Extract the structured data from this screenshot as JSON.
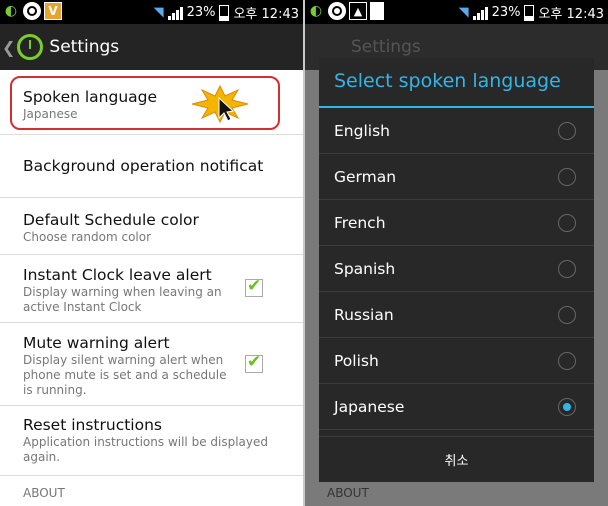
{
  "status": {
    "battery_percent": "23%",
    "time": "오후 12:43",
    "vicon": "V"
  },
  "left": {
    "title": "Settings",
    "items": [
      {
        "title": "Spoken language",
        "subtitle": "Japanese"
      },
      {
        "title": "Background operation notificat",
        "subtitle": ""
      },
      {
        "title": "Default Schedule color",
        "subtitle": "Choose random color"
      },
      {
        "title": "Instant Clock leave alert",
        "subtitle": "Display warning when leaving an active Instant Clock",
        "checked": true
      },
      {
        "title": "Mute warning alert",
        "subtitle": "Display silent warning alert when phone mute is set and a schedule is running.",
        "checked": true
      },
      {
        "title": "Reset instructions",
        "subtitle": "Application instructions will be displayed again."
      }
    ],
    "section": "ABOUT"
  },
  "dialog": {
    "title": "Select spoken language",
    "options": [
      "English",
      "German",
      "French",
      "Spanish",
      "Russian",
      "Polish",
      "Japanese"
    ],
    "selected": "Japanese",
    "cancel": "취소",
    "bg_title": "Settings",
    "bg_section": "ABOUT"
  },
  "colors": {
    "accent": "#33b5e5",
    "check": "#6abf1f",
    "highlight": "#d32f2f",
    "logo": "#7bcd2b"
  }
}
